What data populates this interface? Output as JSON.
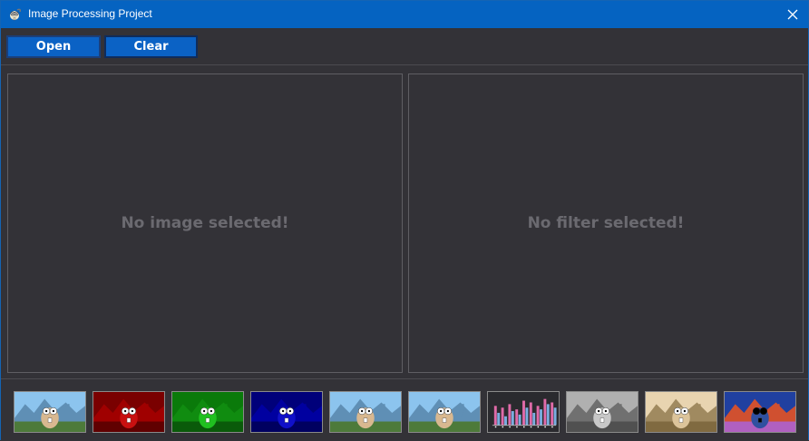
{
  "window": {
    "title": "Image Processing Project",
    "app_icon": "mascot-icon",
    "close_icon": "close-icon"
  },
  "toolbar": {
    "open_label": "Open",
    "clear_label": "Clear"
  },
  "panels": {
    "source_placeholder": "No image selected!",
    "filter_placeholder": "No filter selected!"
  },
  "filters": [
    {
      "name": "original",
      "tint": "#7fb0d8"
    },
    {
      "name": "red-channel",
      "tint": "#b00000"
    },
    {
      "name": "green-channel",
      "tint": "#0a9a0a"
    },
    {
      "name": "blue-channel",
      "tint": "#0000c0"
    },
    {
      "name": "copy",
      "tint": "#7fb0d8"
    },
    {
      "name": "copy-2",
      "tint": "#7fb0d8"
    },
    {
      "name": "histogram",
      "tint": "#2a2a2e"
    },
    {
      "name": "grayscale",
      "tint": "#8a8a8a"
    },
    {
      "name": "sepia",
      "tint": "#b49a70"
    },
    {
      "name": "inverted",
      "tint": "#c04020"
    }
  ],
  "colors": {
    "titlebar": "#0563c1",
    "background": "#333237",
    "button": "#0b62c5",
    "histogram_pink": "#e06aa8",
    "histogram_blue": "#7aaee0"
  }
}
